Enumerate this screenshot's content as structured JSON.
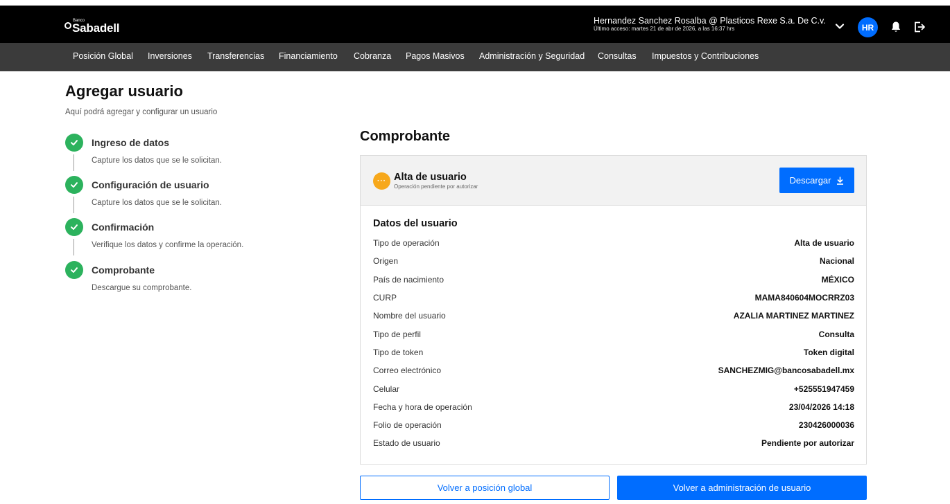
{
  "header": {
    "logo_small": "Banco",
    "logo_name": "Sabadell",
    "user_name": "Hernandez Sanchez Rosalba @ Plasticos Rexe S.a. De C.v.",
    "last_access": "Último acceso: martes 21 de abr de 2026, a las 16:37 hrs",
    "avatar_initials": "HR",
    "icons": [
      "chevron-down-icon",
      "bell-icon",
      "logout-icon"
    ]
  },
  "nav": {
    "items": [
      "Posición Global",
      "Inversiones",
      "Transferencias",
      "Financiamiento",
      "Cobranza",
      "Pagos Masivos",
      "Administración y Seguridad",
      "Consultas",
      "Impuestos y Contribuciones"
    ]
  },
  "page": {
    "title": "Agregar usuario",
    "subtitle": "Aquí podrá agregar y configurar un usuario"
  },
  "steps": [
    {
      "title": "Ingreso de datos",
      "description": "Capture los datos que se le solicitan.",
      "status": "done"
    },
    {
      "title": "Configuración de usuario",
      "description": "Capture los datos que se le solicitan.",
      "status": "done"
    },
    {
      "title": "Confirmación",
      "description": "Verifique los datos y confirme la operación.",
      "status": "done"
    },
    {
      "title": "Comprobante",
      "description": "Descargue su comprobante.",
      "status": "done"
    }
  ],
  "receipt": {
    "section_title": "Comprobante",
    "card_title": "Alta de usuario",
    "card_subtitle": "Operación pendiente por autorizar",
    "pending_icon_text": "···",
    "download_label": "Descargar",
    "data_title": "Datos del usuario",
    "rows": [
      {
        "label": "Tipo de operación",
        "value": "Alta de usuario"
      },
      {
        "label": "Origen",
        "value": "Nacional"
      },
      {
        "label": "País de nacimiento",
        "value": "MÉXICO"
      },
      {
        "label": "CURP",
        "value": "MAMA840604MOCRRZ03"
      },
      {
        "label": "Nombre del usuario",
        "value": "AZALIA MARTINEZ MARTINEZ"
      },
      {
        "label": "Tipo de perfil",
        "value": "Consulta"
      },
      {
        "label": "Tipo de token",
        "value": "Token digital"
      },
      {
        "label": "Correo electrónico",
        "value": "SANCHEZMIG@bancosabadell.mx"
      },
      {
        "label": "Celular",
        "value": "+525551947459"
      },
      {
        "label": "Fecha y hora de operación",
        "value": "23/04/2026 14:18"
      },
      {
        "label": "Folio de operación",
        "value": "230426000036"
      },
      {
        "label": "Estado de usuario",
        "value": "Pendiente por autorizar"
      }
    ]
  },
  "actions": {
    "back_global": "Volver a posición global",
    "back_admin": "Volver a administración de usuario"
  },
  "colors": {
    "primary": "#006dff",
    "success": "#2cb25d",
    "pending": "#f7a81b",
    "topbar": "#000000",
    "navbar": "#3b3b3b"
  }
}
